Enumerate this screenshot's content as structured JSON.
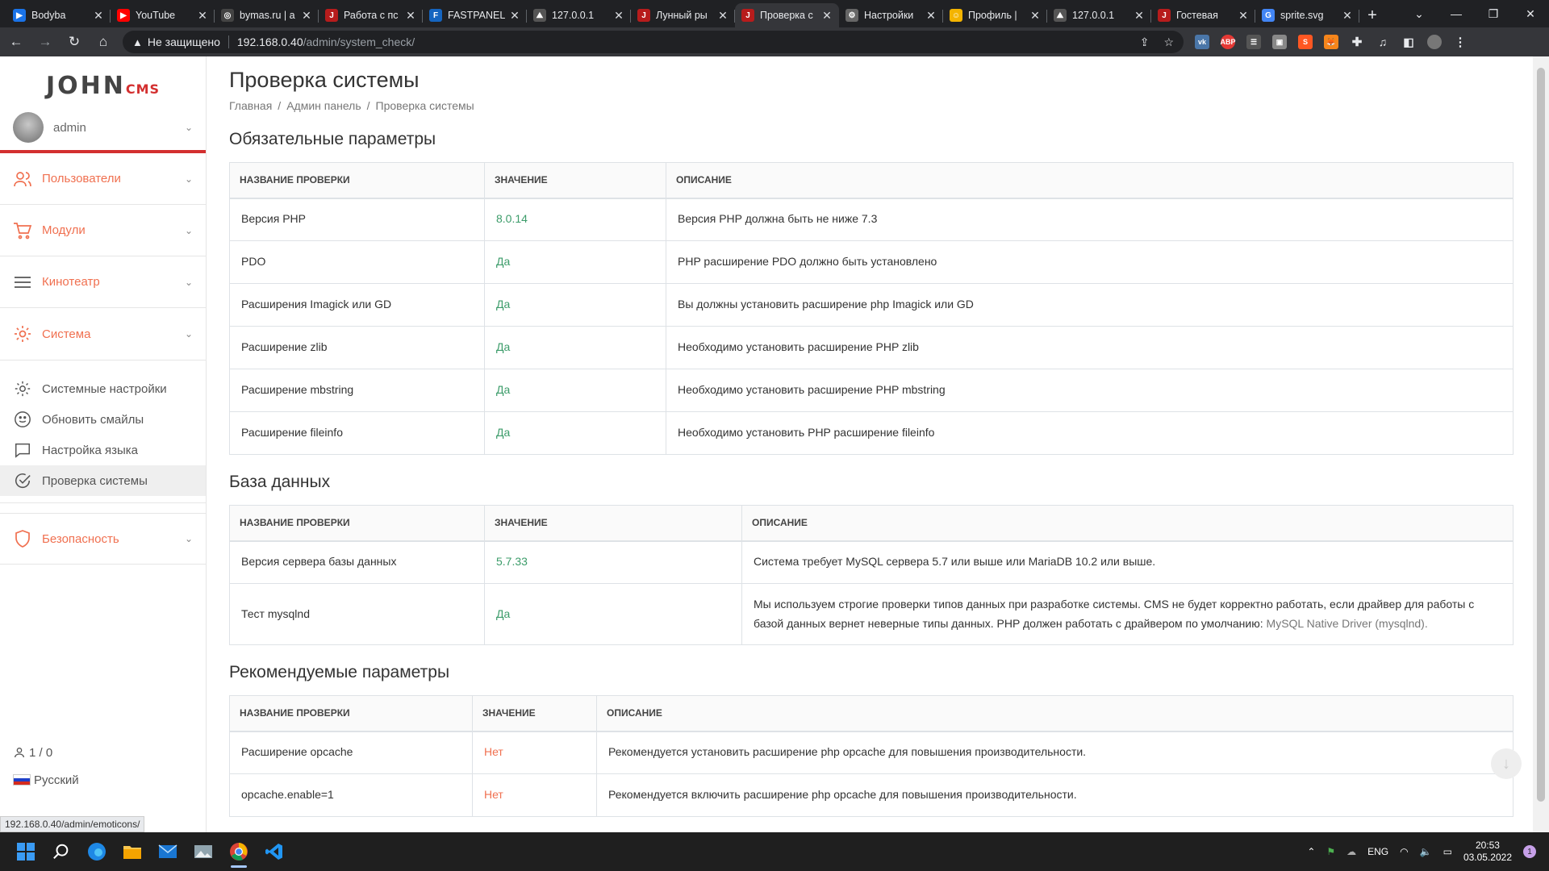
{
  "browser": {
    "tabs": [
      {
        "title": "Bodyba",
        "fav_color": "#1a73e8",
        "fav_glyph": "▶"
      },
      {
        "title": "YouTube",
        "fav_color": "#ff0000",
        "fav_glyph": "▶"
      },
      {
        "title": "bymas.ru | a",
        "fav_color": "#444",
        "fav_glyph": "◎"
      },
      {
        "title": "Работа с пс",
        "fav_color": "#b71c1c",
        "fav_glyph": "J"
      },
      {
        "title": "FASTPANEL",
        "fav_color": "#1565c0",
        "fav_glyph": "F"
      },
      {
        "title": "127.0.0.1",
        "fav_color": "#555",
        "fav_glyph": "⛰"
      },
      {
        "title": "Лунный ры",
        "fav_color": "#b71c1c",
        "fav_glyph": "J"
      },
      {
        "title": "Проверка с",
        "fav_color": "#b71c1c",
        "fav_glyph": "J"
      },
      {
        "title": "Настройки",
        "fav_color": "#666",
        "fav_glyph": "⚙"
      },
      {
        "title": "Профиль |",
        "fav_color": "#f4b400",
        "fav_glyph": "☺"
      },
      {
        "title": "127.0.0.1",
        "fav_color": "#555",
        "fav_glyph": "⛰"
      },
      {
        "title": "Гостевая",
        "fav_color": "#b71c1c",
        "fav_glyph": "J"
      },
      {
        "title": "sprite.svg",
        "fav_color": "#4285f4",
        "fav_glyph": "G"
      }
    ],
    "insecure_label": "Не защищено",
    "url_host": "192.168.0.40",
    "url_path": "/admin/system_check/",
    "status_url": "192.168.0.40/admin/emoticons/"
  },
  "sidebar": {
    "logo_main": "JOHN",
    "logo_sub": "CMS",
    "user_name": "admin",
    "menu": {
      "users": "Пользователи",
      "modules": "Модули",
      "cinema": "Кинотеатр",
      "system": "Система",
      "security": "Безопасность"
    },
    "system_items": {
      "settings": "Системные настройки",
      "smiles": "Обновить смайлы",
      "language": "Настройка языка",
      "check": "Проверка системы"
    },
    "online": "1 / 0",
    "language": "Русский"
  },
  "main": {
    "title": "Проверка системы",
    "breadcrumb": [
      "Главная",
      "Админ панель",
      "Проверка системы"
    ],
    "headers": {
      "name": "НАЗВАНИЕ ПРОВЕРКИ",
      "value": "ЗНАЧЕНИЕ",
      "desc": "ОПИСАНИЕ"
    },
    "required": {
      "title": "Обязательные параметры",
      "rows": [
        {
          "name": "Версия PHP",
          "value": "8.0.14",
          "desc": "Версия PHP должна быть не ниже 7.3"
        },
        {
          "name": "PDO",
          "value": "Да",
          "desc": "PHP расширение PDO должно быть установлено"
        },
        {
          "name": "Расширения Imagick или GD",
          "value": "Да",
          "desc": "Вы должны установить расширение php Imagick или GD"
        },
        {
          "name": "Расширение zlib",
          "value": "Да",
          "desc": "Необходимо установить расширение PHP zlib"
        },
        {
          "name": "Расширение mbstring",
          "value": "Да",
          "desc": "Необходимо установить расширение PHP mbstring"
        },
        {
          "name": "Расширение fileinfo",
          "value": "Да",
          "desc": "Необходимо установить PHP расширение fileinfo"
        }
      ]
    },
    "database": {
      "title": "База данных",
      "rows": [
        {
          "name": "Версия сервера базы данных",
          "value": "5.7.33",
          "desc": "Система требует MySQL сервера 5.7 или выше или MariaDB 10.2 или выше."
        },
        {
          "name": "Тест mysqlnd",
          "value": "Да",
          "desc": "Мы используем строгие проверки типов данных при разработке системы. CMS не будет корректно работать, если драйвер для работы с базой данных вернет неверные типы данных. PHP должен работать с драйвером по умолчанию: ",
          "desc_link": "MySQL Native Driver (mysqlnd)."
        }
      ]
    },
    "recommended": {
      "title": "Рекомендуемые параметры",
      "rows": [
        {
          "name": "Расширение opcache",
          "value": "Нет",
          "desc": "Рекомендуется установить расширение php opcache для повышения производительности."
        },
        {
          "name": "opcache.enable=1",
          "value": "Нет",
          "desc": "Рекомендуется включить расширение php opcache для повышения производительности."
        }
      ]
    }
  },
  "taskbar": {
    "lang": "ENG",
    "time": "20:53",
    "date": "03.05.2022",
    "notifications": "1"
  },
  "colors": {
    "accent": "#f07050",
    "ok": "#3c9c6a",
    "brand_red": "#d32f2f"
  }
}
